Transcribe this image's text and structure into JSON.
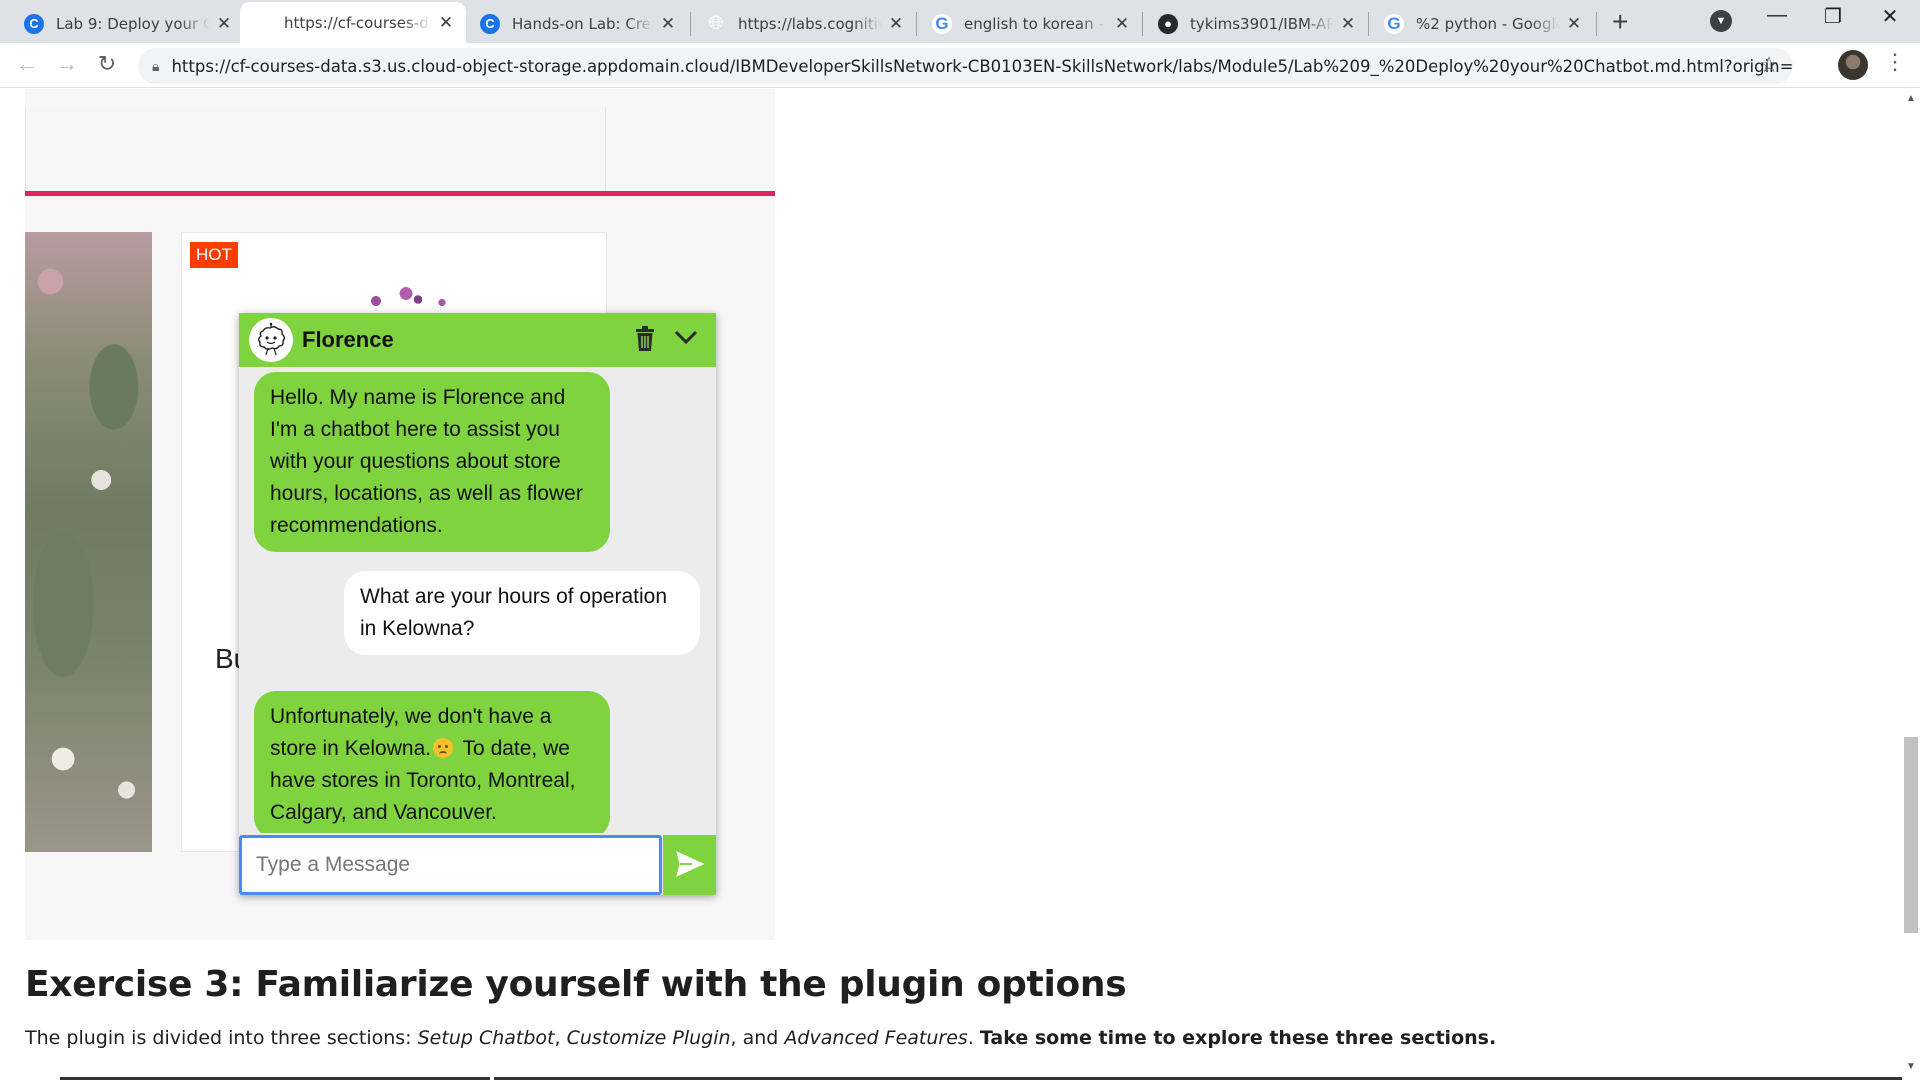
{
  "tabs": [
    {
      "title": "Lab 9: Deploy your Ch",
      "icon": "coursera-icon"
    },
    {
      "title": "https://cf-courses-data",
      "icon": "globe-icon",
      "active": true
    },
    {
      "title": "Hands-on Lab: Creating",
      "icon": "coursera-icon"
    },
    {
      "title": "https://labs.cognitiveclass",
      "icon": "globe-icon"
    },
    {
      "title": "english to korean - Go",
      "icon": "google-icon"
    },
    {
      "title": "tykims3901/IBM-APP",
      "icon": "github-icon"
    },
    {
      "title": "%2 python - Google",
      "icon": "google-icon"
    }
  ],
  "toolbar": {
    "url": "https://cf-courses-data.s3.us.cloud-object-storage.appdomain.cloud/IBMDeveloperSkillsNetwork-CB0103EN-SkillsNetwork/labs/Module5/Lab%209_%20Deploy%20your%20Chatbot.md.html?origin=ww..."
  },
  "product": {
    "badge": "HOT",
    "name_partial": "Bu"
  },
  "chat": {
    "bot_name": "Florence",
    "messages": [
      {
        "from": "bot",
        "text": "Hello. My name is Florence and I'm a chatbot here to assist you with your questions about store hours, locations, as well as flower recommendations."
      },
      {
        "from": "user",
        "text": "What are your hours of operation in Kelowna?"
      },
      {
        "from": "bot",
        "text_before_emoji": "Unfortunately, we don't have a store in Kelowna.",
        "text_after_emoji": " To date, we have stores in Toronto, Montreal, Calgary, and Vancouver."
      }
    ],
    "input_placeholder": "Type a Message",
    "accent_color": "#7fd33f"
  },
  "exercise": {
    "heading": "Exercise 3: Familiarize yourself with the plugin options",
    "text_prefix": "The plugin is divided into three sections: ",
    "section1": "Setup Chatbot",
    "sep1": ", ",
    "section2": "Customize Plugin",
    "sep2": ", and ",
    "section3": "Advanced Features",
    "sep3": ". ",
    "bold_text": "Take some time to explore these three sections."
  }
}
